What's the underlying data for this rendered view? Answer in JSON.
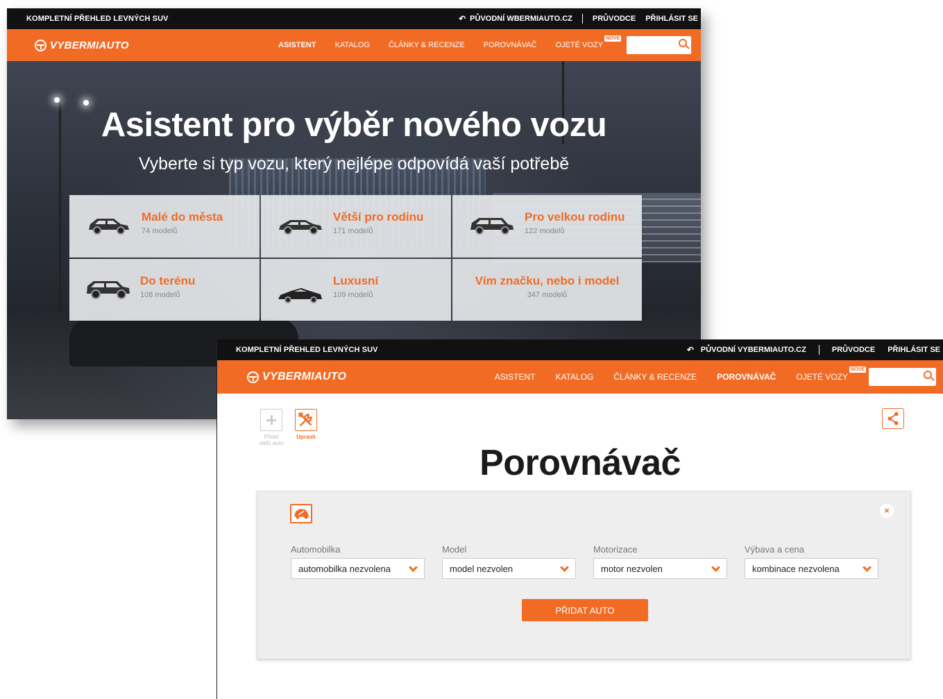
{
  "window1": {
    "topbar": {
      "promo": "KOMPLETNÍ PŘEHLED LEVNÝCH SUV",
      "back_link": "PŮVODNÍ WBERMIAUTO.CZ",
      "guide": "PRŮVODCE",
      "login": "PŘIHLÁSIT SE"
    },
    "logo": "VYBERMIAUTO",
    "menu": {
      "assistant": "ASISTENT",
      "catalog": "KATALOG",
      "articles": "ČLÁNKY & RECENZE",
      "comparator": "POROVNÁVAČ",
      "used": "OJETÉ VOZY",
      "badge": "NOVÉ"
    },
    "hero": {
      "title": "Asistent pro výběr nového vozu",
      "subtitle": "Vyberte si typ vozu, který nejlépe odpovídá vaší potřebě"
    },
    "categories": [
      {
        "name": "Malé do města",
        "count": "74 modelů"
      },
      {
        "name": "Větší pro rodinu",
        "count": "171 modelů"
      },
      {
        "name": "Pro velkou rodinu",
        "count": "122 modelů"
      },
      {
        "name": "Do terénu",
        "count": "108 modelů"
      },
      {
        "name": "Luxusní",
        "count": "109 modelů"
      },
      {
        "name": "Vím značku, nebo i model",
        "count": "347 modelů"
      }
    ]
  },
  "window2": {
    "topbar": {
      "promo": "KOMPLETNÍ PŘEHLED LEVNÝCH SUV",
      "back_link": "PŮVODNÍ VYBERMIAUTO.CZ",
      "guide": "PRŮVODCE",
      "login": "PŘIHLÁSIT SE"
    },
    "logo": "VYBERMIAUTO",
    "menu": {
      "assistant": "ASISTENT",
      "catalog": "KATALOG",
      "articles": "ČLÁNKY & RECENZE",
      "comparator": "POROVNÁVAČ",
      "used": "OJETÉ VOZY",
      "badge": "NOVÉ"
    },
    "tools": {
      "add_label": "Přidat další auto",
      "edit_label": "Upravit"
    },
    "title": "Porovnávač",
    "fields": [
      {
        "label": "Automobilka",
        "value": "automobilka nezvolena"
      },
      {
        "label": "Model",
        "value": "model nezvolen"
      },
      {
        "label": "Motorizace",
        "value": "motor nezvolen"
      },
      {
        "label": "Výbava a cena",
        "value": "kombinace nezvolena"
      }
    ],
    "add_button": "PŘIDAT AUTO",
    "close_glyph": "×"
  },
  "colors": {
    "accent": "#f26b24",
    "topbar": "#111111",
    "panel": "#eeeeee"
  }
}
